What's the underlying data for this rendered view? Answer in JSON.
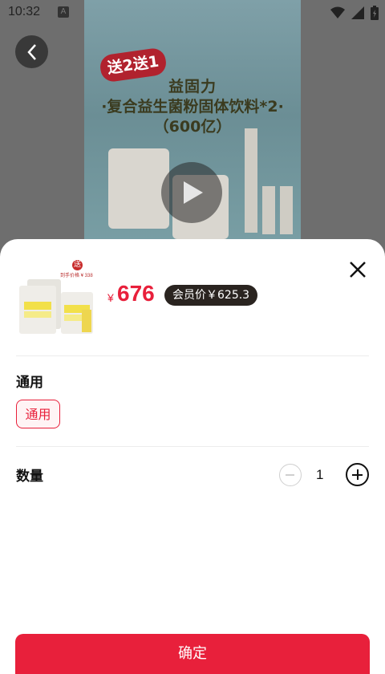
{
  "status_bar": {
    "time": "10:32",
    "notification_icon": "A"
  },
  "media": {
    "promo_badge": "送2送1",
    "line1": "益固力",
    "line2": "·复合益生菌粉固体饮料*2·",
    "line3": "（600亿）",
    "play_icon": "play-icon"
  },
  "sheet": {
    "thumb_badge": "送",
    "thumb_sub": "到手价格 ¥ 338",
    "price_symbol": "¥",
    "price": "676",
    "member_price": "会员价￥625.3",
    "spec_title": "通用",
    "spec_option": "通用",
    "qty_label": "数量",
    "qty_value": "1",
    "confirm": "确定"
  },
  "colors": {
    "accent": "#e8203b",
    "member_badge_bg": "#2a2420"
  }
}
